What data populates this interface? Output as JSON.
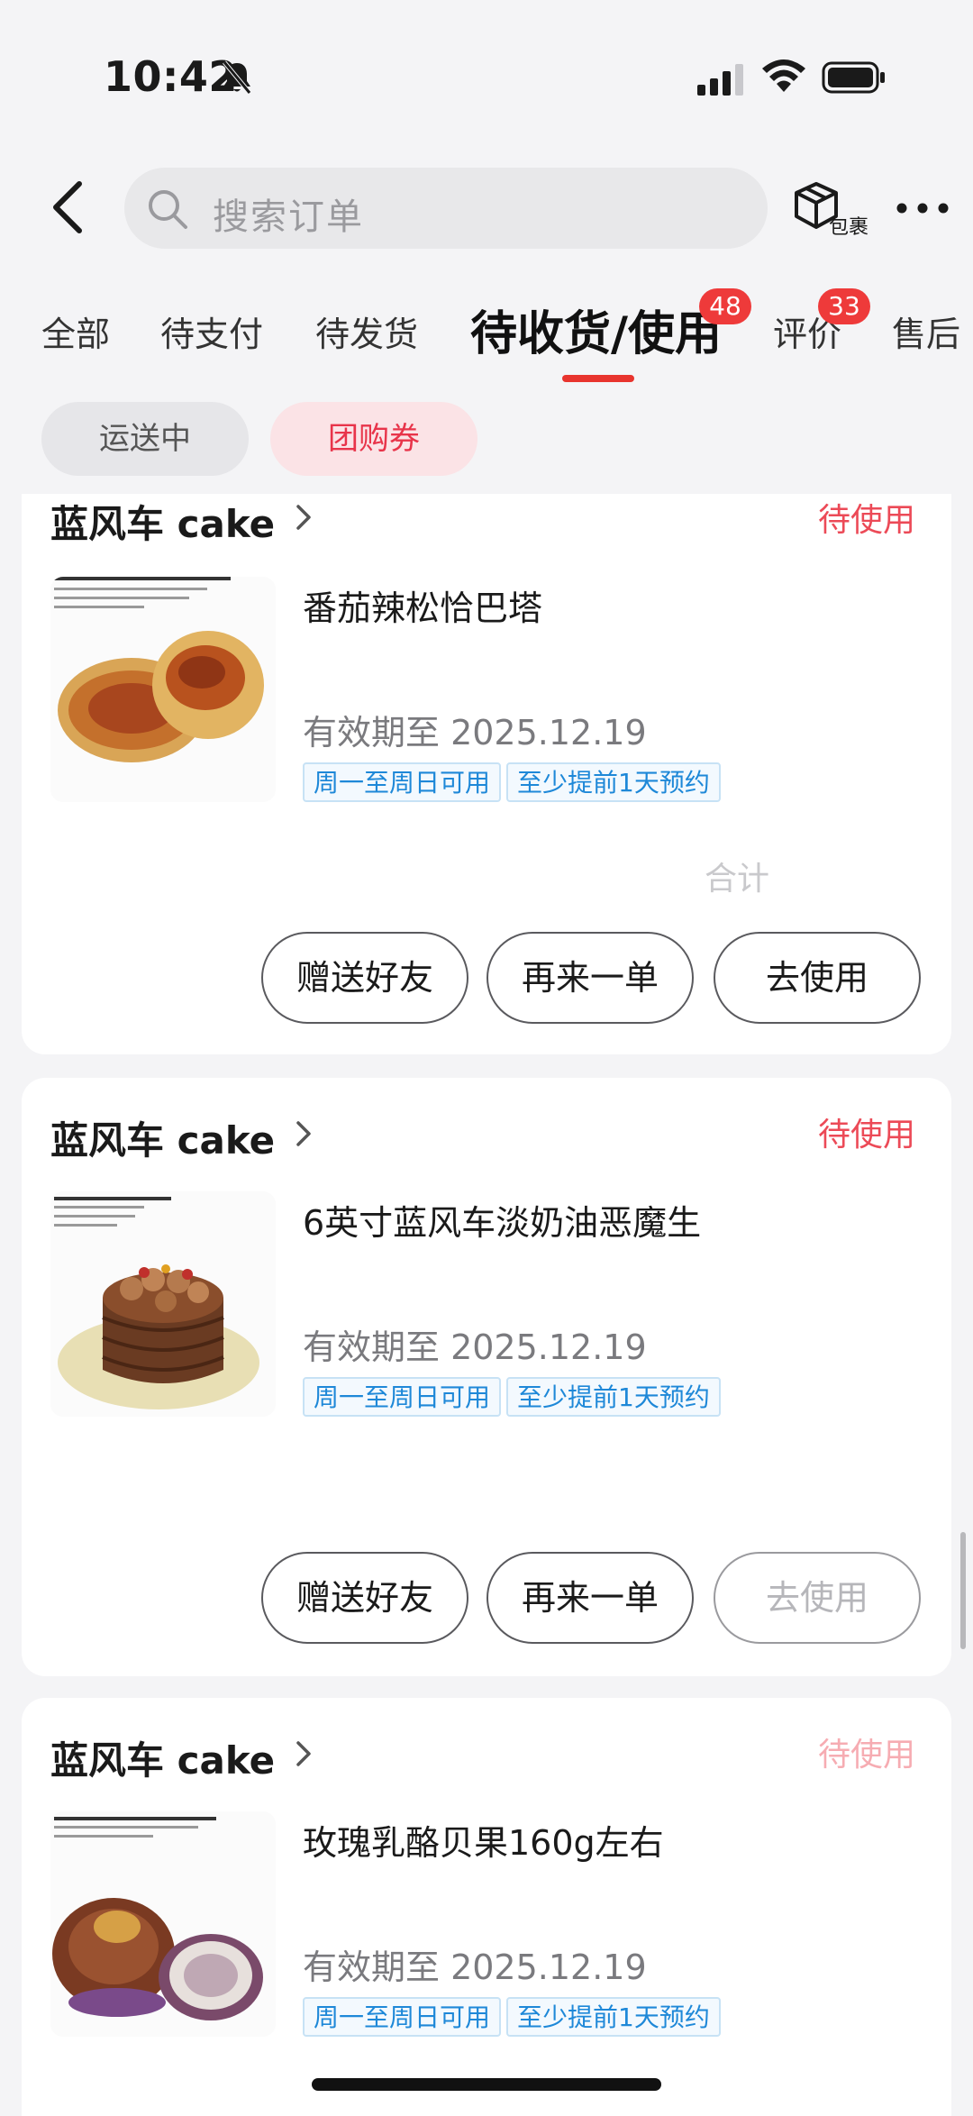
{
  "status_bar": {
    "time": "10:42"
  },
  "header": {
    "search_placeholder": "搜索订单",
    "package_label": "包裹"
  },
  "tabs": [
    {
      "label": "全部"
    },
    {
      "label": "待支付"
    },
    {
      "label": "待发货"
    },
    {
      "label": "待收货/使用",
      "badge": "48",
      "active": true
    },
    {
      "label": "评价",
      "badge": "33"
    },
    {
      "label": "售后"
    }
  ],
  "subtabs": [
    {
      "label": "运送中"
    },
    {
      "label": "团购券",
      "active": true
    }
  ],
  "orders": [
    {
      "shop": "蓝风车 cake",
      "status": "待使用",
      "title": "番茄辣松恰巴塔",
      "validity": "有效期至 2025.12.19",
      "tags": [
        "周一至周日可用",
        "至少提前1天预约"
      ],
      "total_label": "合计",
      "buttons": [
        "赠送好友",
        "再来一单",
        "去使用"
      ]
    },
    {
      "shop": "蓝风车 cake",
      "status": "待使用",
      "title": "6英寸蓝风车淡奶油恶魔生",
      "validity": "有效期至 2025.12.19",
      "tags": [
        "周一至周日可用",
        "至少提前1天预约"
      ],
      "buttons": [
        "赠送好友",
        "再来一单",
        "去使用"
      ]
    },
    {
      "shop": "蓝风车 cake",
      "status": "待使用",
      "title": "玫瑰乳酪贝果160g左右",
      "validity": "有效期至 2025.12.19",
      "tags": [
        "周一至周日可用",
        "至少提前1天预约"
      ]
    }
  ],
  "colors": {
    "accent": "#e8342e",
    "status_red": "#ec4a57",
    "tag_blue": "#1e88d8"
  }
}
